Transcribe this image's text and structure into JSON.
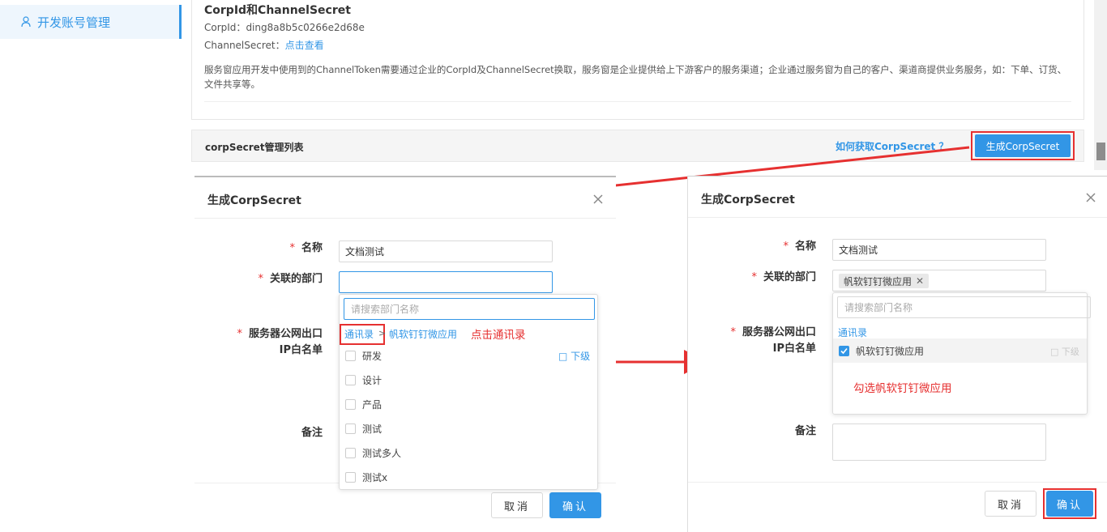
{
  "sidebar": {
    "item_label": "开发账号管理"
  },
  "info": {
    "title": "CorpId和ChannelSecret",
    "corpid_label": "CorpId：",
    "corpid_value": "ding8a8b5c0266e2d68e",
    "channel_secret_label": "ChannelSecret：",
    "channel_secret_link": "点击查看",
    "description": "服务窗应用开发中使用到的ChannelToken需要通过企业的CorpId及ChannelSecret换取，服务窗是企业提供给上下游客户的服务渠道；企业通过服务窗为自己的客户、渠道商提供业务服务，如：下单、订货、文件共享等。"
  },
  "list_bar": {
    "label": "corpSecret管理列表",
    "help_link": "如何获取CorpSecret ？",
    "generate_button": "生成CorpSecret"
  },
  "dialog_left": {
    "title": "生成CorpSecret",
    "name_label": "名称",
    "name_value": "文档测试",
    "dept_label": "关联的部门",
    "ip_label_line1": "服务器公网出口",
    "ip_label_line2": "IP白名单",
    "remark_label": "备注",
    "search_placeholder": "请搜索部门名称",
    "crumb_root": "通讯录",
    "crumb_sep": ">",
    "crumb_current": "帆软钉钉微应用",
    "note": "点击通讯录",
    "sub_link": "□ 下级",
    "departments": [
      "研发",
      "设计",
      "产品",
      "测试",
      "测试多人",
      "测试x"
    ],
    "cancel": "取消",
    "ok": "确认"
  },
  "dialog_right": {
    "title": "生成CorpSecret",
    "name_label": "名称",
    "name_value": "文档测试",
    "dept_label": "关联的部门",
    "tag_value": "帆软钉钉微应用",
    "tag_remove": "✕",
    "ip_label_line1": "服务器公网出口",
    "ip_label_line2": "IP白名单",
    "remark_label": "备注",
    "search_placeholder": "请搜索部门名称",
    "crumb_root": "通讯录",
    "selected_item": "帆软钉钉微应用",
    "sub_link": "□ 下级",
    "note": "勾选帆软钉钉微应用",
    "cancel": "取消",
    "ok": "确认"
  },
  "colors": {
    "accent": "#3296e6",
    "highlight_red": "#e63030"
  }
}
